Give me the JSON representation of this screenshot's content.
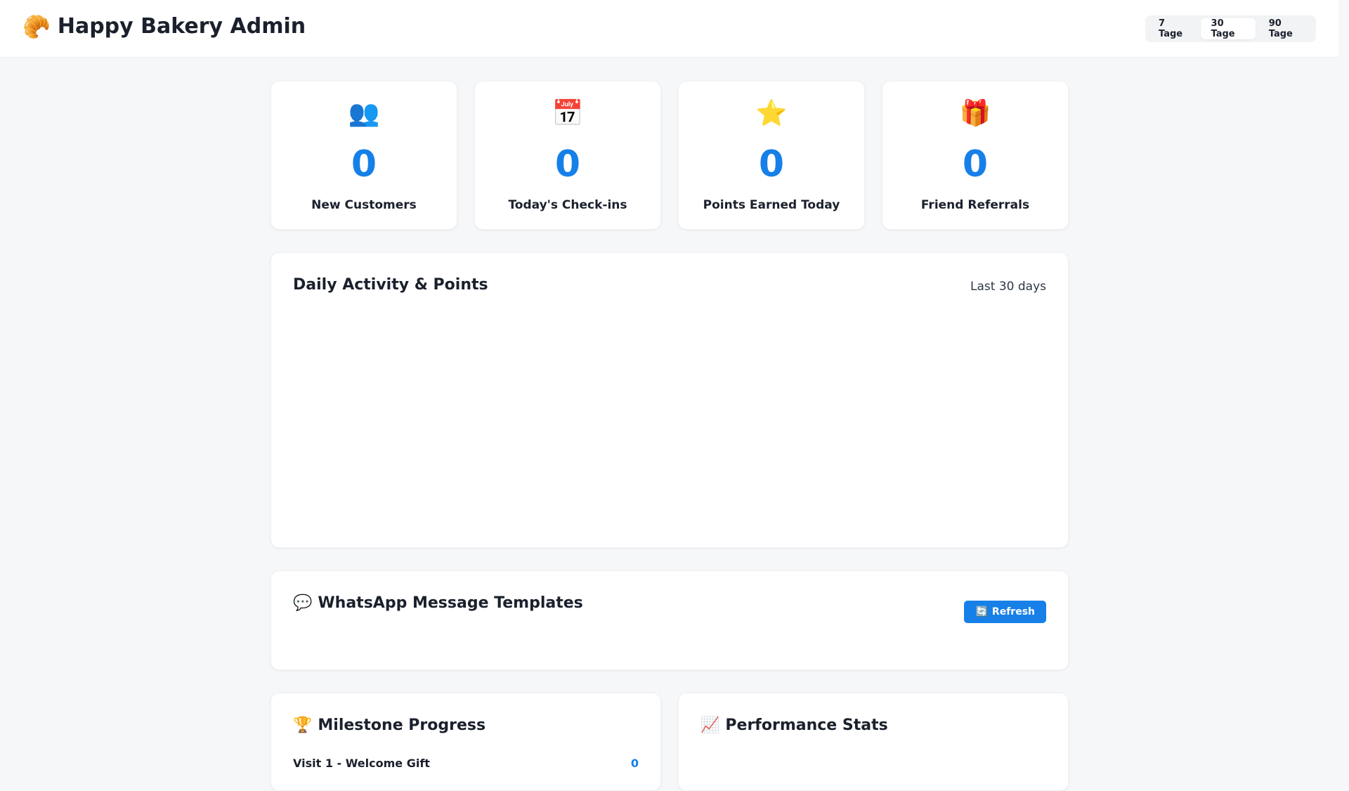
{
  "header": {
    "brand_icon": "🥐",
    "title": "Happy Bakery Admin",
    "ranges": [
      {
        "label": "7 Tage",
        "active": false
      },
      {
        "label": "30 Tage",
        "active": true
      },
      {
        "label": "90 Tage",
        "active": false
      }
    ]
  },
  "stats": [
    {
      "icon": "👥",
      "icon_name": "people-icon",
      "value": "0",
      "label": "New Customers"
    },
    {
      "icon": "📅",
      "icon_name": "calendar-icon",
      "value": "0",
      "label": "Today's Check-ins"
    },
    {
      "icon": "⭐",
      "icon_name": "star-icon",
      "value": "0",
      "label": "Points Earned Today"
    },
    {
      "icon": "🎁",
      "icon_name": "gift-icon",
      "value": "0",
      "label": "Friend Referrals"
    }
  ],
  "activity": {
    "title": "Daily Activity & Points",
    "subtitle": "Last 30 days"
  },
  "whatsapp": {
    "icon": "💬",
    "title": "WhatsApp Message Templates",
    "refresh_icon": "🔄",
    "refresh_label": "Refresh"
  },
  "milestones": {
    "icon": "🏆",
    "title": "Milestone Progress",
    "first_item_label": "Visit 1 - Welcome Gift",
    "first_item_count": "0"
  },
  "performance": {
    "icon": "📈",
    "title": "Performance Stats"
  },
  "colors": {
    "accent": "#1680e8",
    "background": "#f6f7f9",
    "card": "#ffffff",
    "text": "#1a202c"
  }
}
